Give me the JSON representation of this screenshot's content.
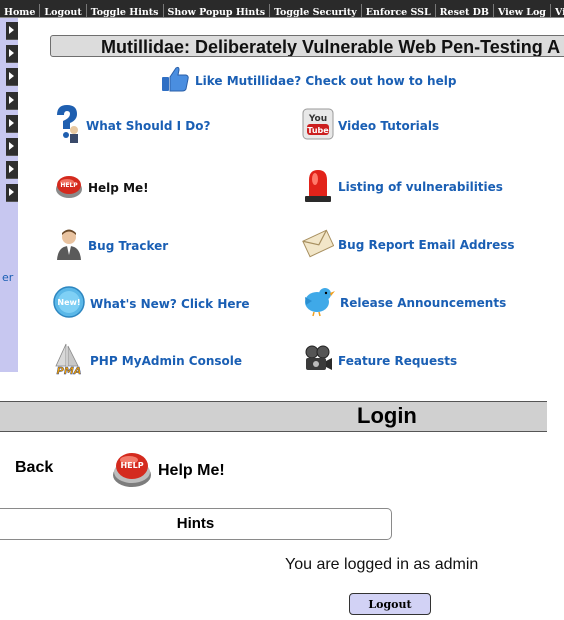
{
  "nav": {
    "items": [
      "Home",
      "Logout",
      "Toggle Hints",
      "Show Popup Hints",
      "Toggle Security",
      "Enforce SSL",
      "Reset DB",
      "View Log",
      "View C"
    ]
  },
  "sidebar": {
    "partial_text": "er"
  },
  "header": {
    "title": "Mutillidae: Deliberately Vulnerable Web Pen-Testing A"
  },
  "like": {
    "text": "Like Mutillidae? Check out how to help"
  },
  "links": {
    "what_should_i_do": "What Should I Do?",
    "video_tutorials": "Video Tutorials",
    "help_me": "Help Me!",
    "listing_vulns": "Listing of vulnerabilities",
    "bug_tracker": "Bug Tracker",
    "bug_email": "Bug Report Email Address",
    "whats_new": "What's New? Click Here",
    "release": "Release Announcements",
    "phpmyadmin": "PHP MyAdmin Console",
    "feature_requests": "Feature Requests"
  },
  "icons": {
    "youtube_top": "You",
    "youtube_bottom": "Tube",
    "help_badge": "HELP",
    "new_badge": "New!",
    "pma": "PMA"
  },
  "login": {
    "title": "Login",
    "back": "Back",
    "help_me": "Help Me!",
    "hints": "Hints",
    "status": "You are logged in as admin",
    "logout_button": "Logout"
  },
  "colors": {
    "link_blue": "#1a5fb4",
    "nav_bg": "#2a2a2a",
    "sidebar_bg": "#c7c7f0",
    "button_bg": "#d2d2f5"
  }
}
